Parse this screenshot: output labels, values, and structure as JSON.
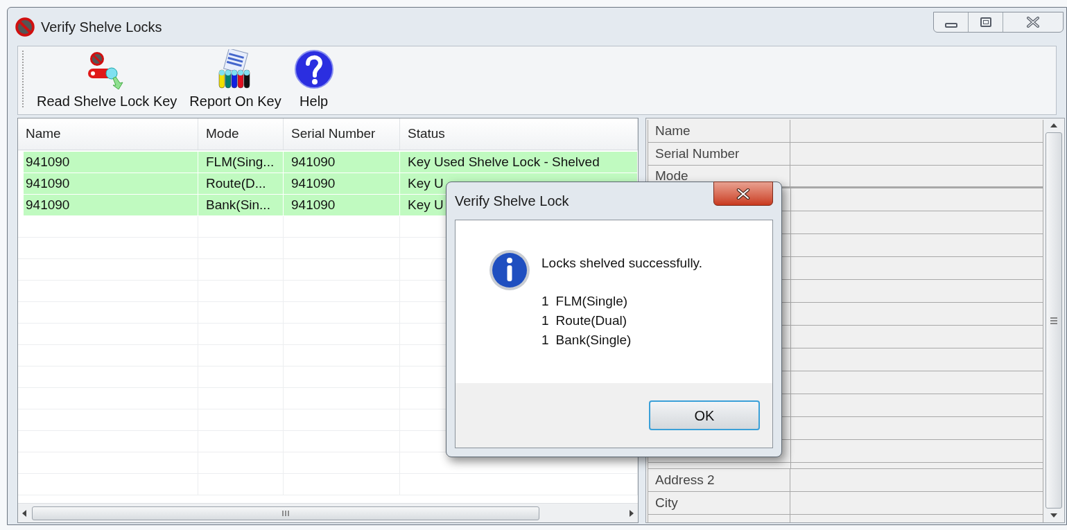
{
  "window": {
    "title": "Verify Shelve Locks"
  },
  "toolbar": [
    {
      "kind": "read",
      "label": "Read Shelve Lock Key"
    },
    {
      "kind": "report",
      "label": "Report On Key"
    },
    {
      "kind": "help",
      "label": "Help"
    }
  ],
  "table": {
    "columns": [
      "Name",
      "Mode",
      "Serial Number",
      "Status"
    ],
    "rows": [
      {
        "highlighted": true,
        "cells": [
          "941090",
          "FLM(Sing...",
          "941090",
          "Key Used Shelve Lock - Shelved"
        ]
      },
      {
        "highlighted": true,
        "cells": [
          "941090",
          "Route(D...",
          "941090",
          "Key U"
        ]
      },
      {
        "highlighted": true,
        "cells": [
          "941090",
          "Bank(Sin...",
          "941090",
          "Key U"
        ]
      }
    ]
  },
  "properties": {
    "top": [
      "Name",
      "Serial Number",
      "Mode"
    ],
    "bottom": [
      "Address 2",
      "City"
    ]
  },
  "dialog": {
    "title": "Verify Shelve Lock",
    "message": "Locks shelved successfully.",
    "items": [
      {
        "count": "1",
        "name": "FLM(Single)"
      },
      {
        "count": "1",
        "name": "Route(Dual)"
      },
      {
        "count": "1",
        "name": "Bank(Single)"
      }
    ],
    "button": "OK"
  }
}
